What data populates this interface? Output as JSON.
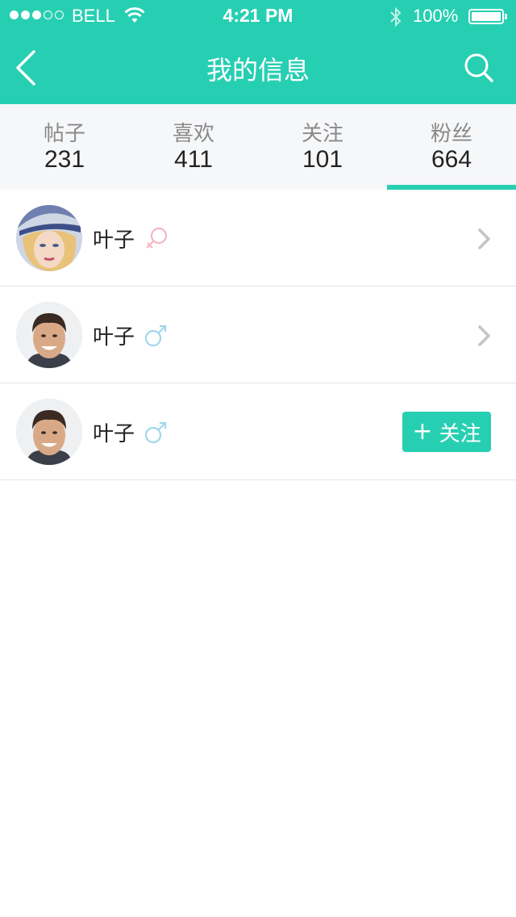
{
  "status_bar": {
    "carrier": "BELL",
    "time": "4:21 PM",
    "battery": "100%",
    "signal_dots": [
      true,
      true,
      true,
      false,
      false
    ]
  },
  "nav": {
    "title": "我的信息",
    "back_icon": "chevron-left-icon",
    "search_icon": "search-icon"
  },
  "tabs": [
    {
      "label": "帖子",
      "count": "231",
      "active": false
    },
    {
      "label": "喜欢",
      "count": "411",
      "active": false
    },
    {
      "label": "关注",
      "count": "101",
      "active": false
    },
    {
      "label": "粉丝",
      "count": "664",
      "active": true
    }
  ],
  "list": [
    {
      "name": "叶子",
      "gender": "female",
      "action": "chevron"
    },
    {
      "name": "叶子",
      "gender": "male",
      "action": "chevron"
    },
    {
      "name": "叶子",
      "gender": "male",
      "action": "follow"
    }
  ],
  "follow_button": {
    "label": "关注",
    "icon": "plus-icon"
  },
  "colors": {
    "accent": "#27cfb2",
    "female": "#f4b6c2",
    "male": "#9fd8ec",
    "tab_bg": "#f6f7f9"
  }
}
